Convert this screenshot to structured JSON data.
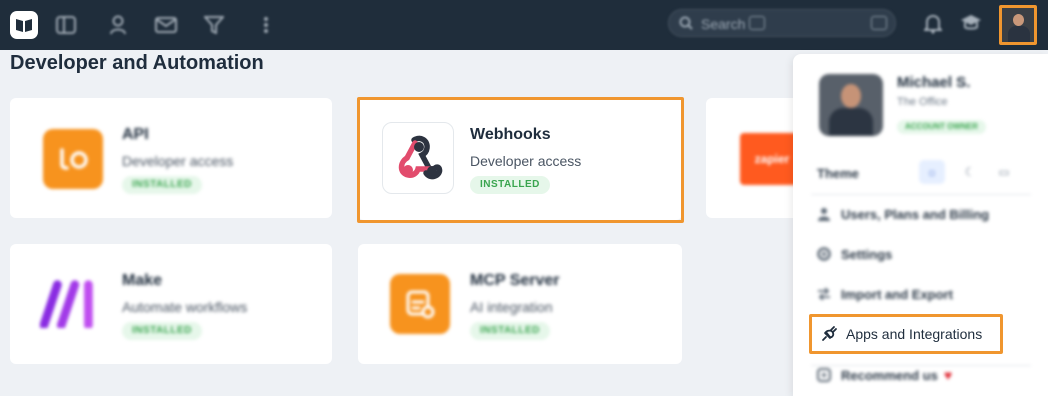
{
  "topbar": {
    "logo_icon": "book-logo-icon",
    "nav_icons": [
      "kanban-icon",
      "user-icon",
      "mail-icon",
      "filter-icon",
      "more-vertical-icon"
    ],
    "search": {
      "placeholder": "Search",
      "icon": "search-icon"
    },
    "notification_icon": "bell-icon",
    "help_icon": "graduation-cap-icon",
    "avatar_icon": "user-avatar-icon"
  },
  "page": {
    "title": "Developer and Automation"
  },
  "cards": [
    {
      "name": "API",
      "desc": "Developer access",
      "badge": "INSTALLED",
      "icon": "api-logo-icon",
      "color": "#f7931e"
    },
    {
      "name": "Webhooks",
      "desc": "Developer access",
      "badge": "INSTALLED",
      "icon": "webhook-logo-icon",
      "color": "#ffffff"
    },
    {
      "name": "",
      "desc": "",
      "badge": "",
      "icon": "zapier-logo-icon",
      "color": "#ff5a1f",
      "logo_text": "zapier"
    },
    {
      "name": "Make",
      "desc": "Automate workflows",
      "badge": "INSTALLED",
      "icon": "make-logo-icon",
      "color": "#7b2fe0"
    },
    {
      "name": "MCP Server",
      "desc": "AI integration",
      "badge": "INSTALLED",
      "icon": "mcp-logo-icon",
      "color": "#f7931e"
    }
  ],
  "dropdown": {
    "profile": {
      "name": "Michael S.",
      "org": "The Office",
      "badge": "ACCOUNT OWNER"
    },
    "theme": {
      "label": "Theme",
      "options": [
        "sun-icon",
        "moon-icon",
        "monitor-icon"
      ],
      "selected": "sun-icon"
    },
    "items": [
      {
        "label": "Users, Plans and Billing",
        "icon": "user-icon"
      },
      {
        "label": "Settings",
        "icon": "gear-icon"
      },
      {
        "label": "Import and Export",
        "icon": "transfer-icon"
      },
      {
        "label": "Apps and Integrations",
        "icon": "plug-icon"
      },
      {
        "label": "Recommend us",
        "icon": "share-icon",
        "suffix_icon": "heart-icon"
      }
    ]
  },
  "colors": {
    "highlight": "#f0962f",
    "topbar": "#1f2d3b",
    "installed_badge_bg": "#e6f7ea",
    "installed_badge_text": "#3aa54f"
  }
}
